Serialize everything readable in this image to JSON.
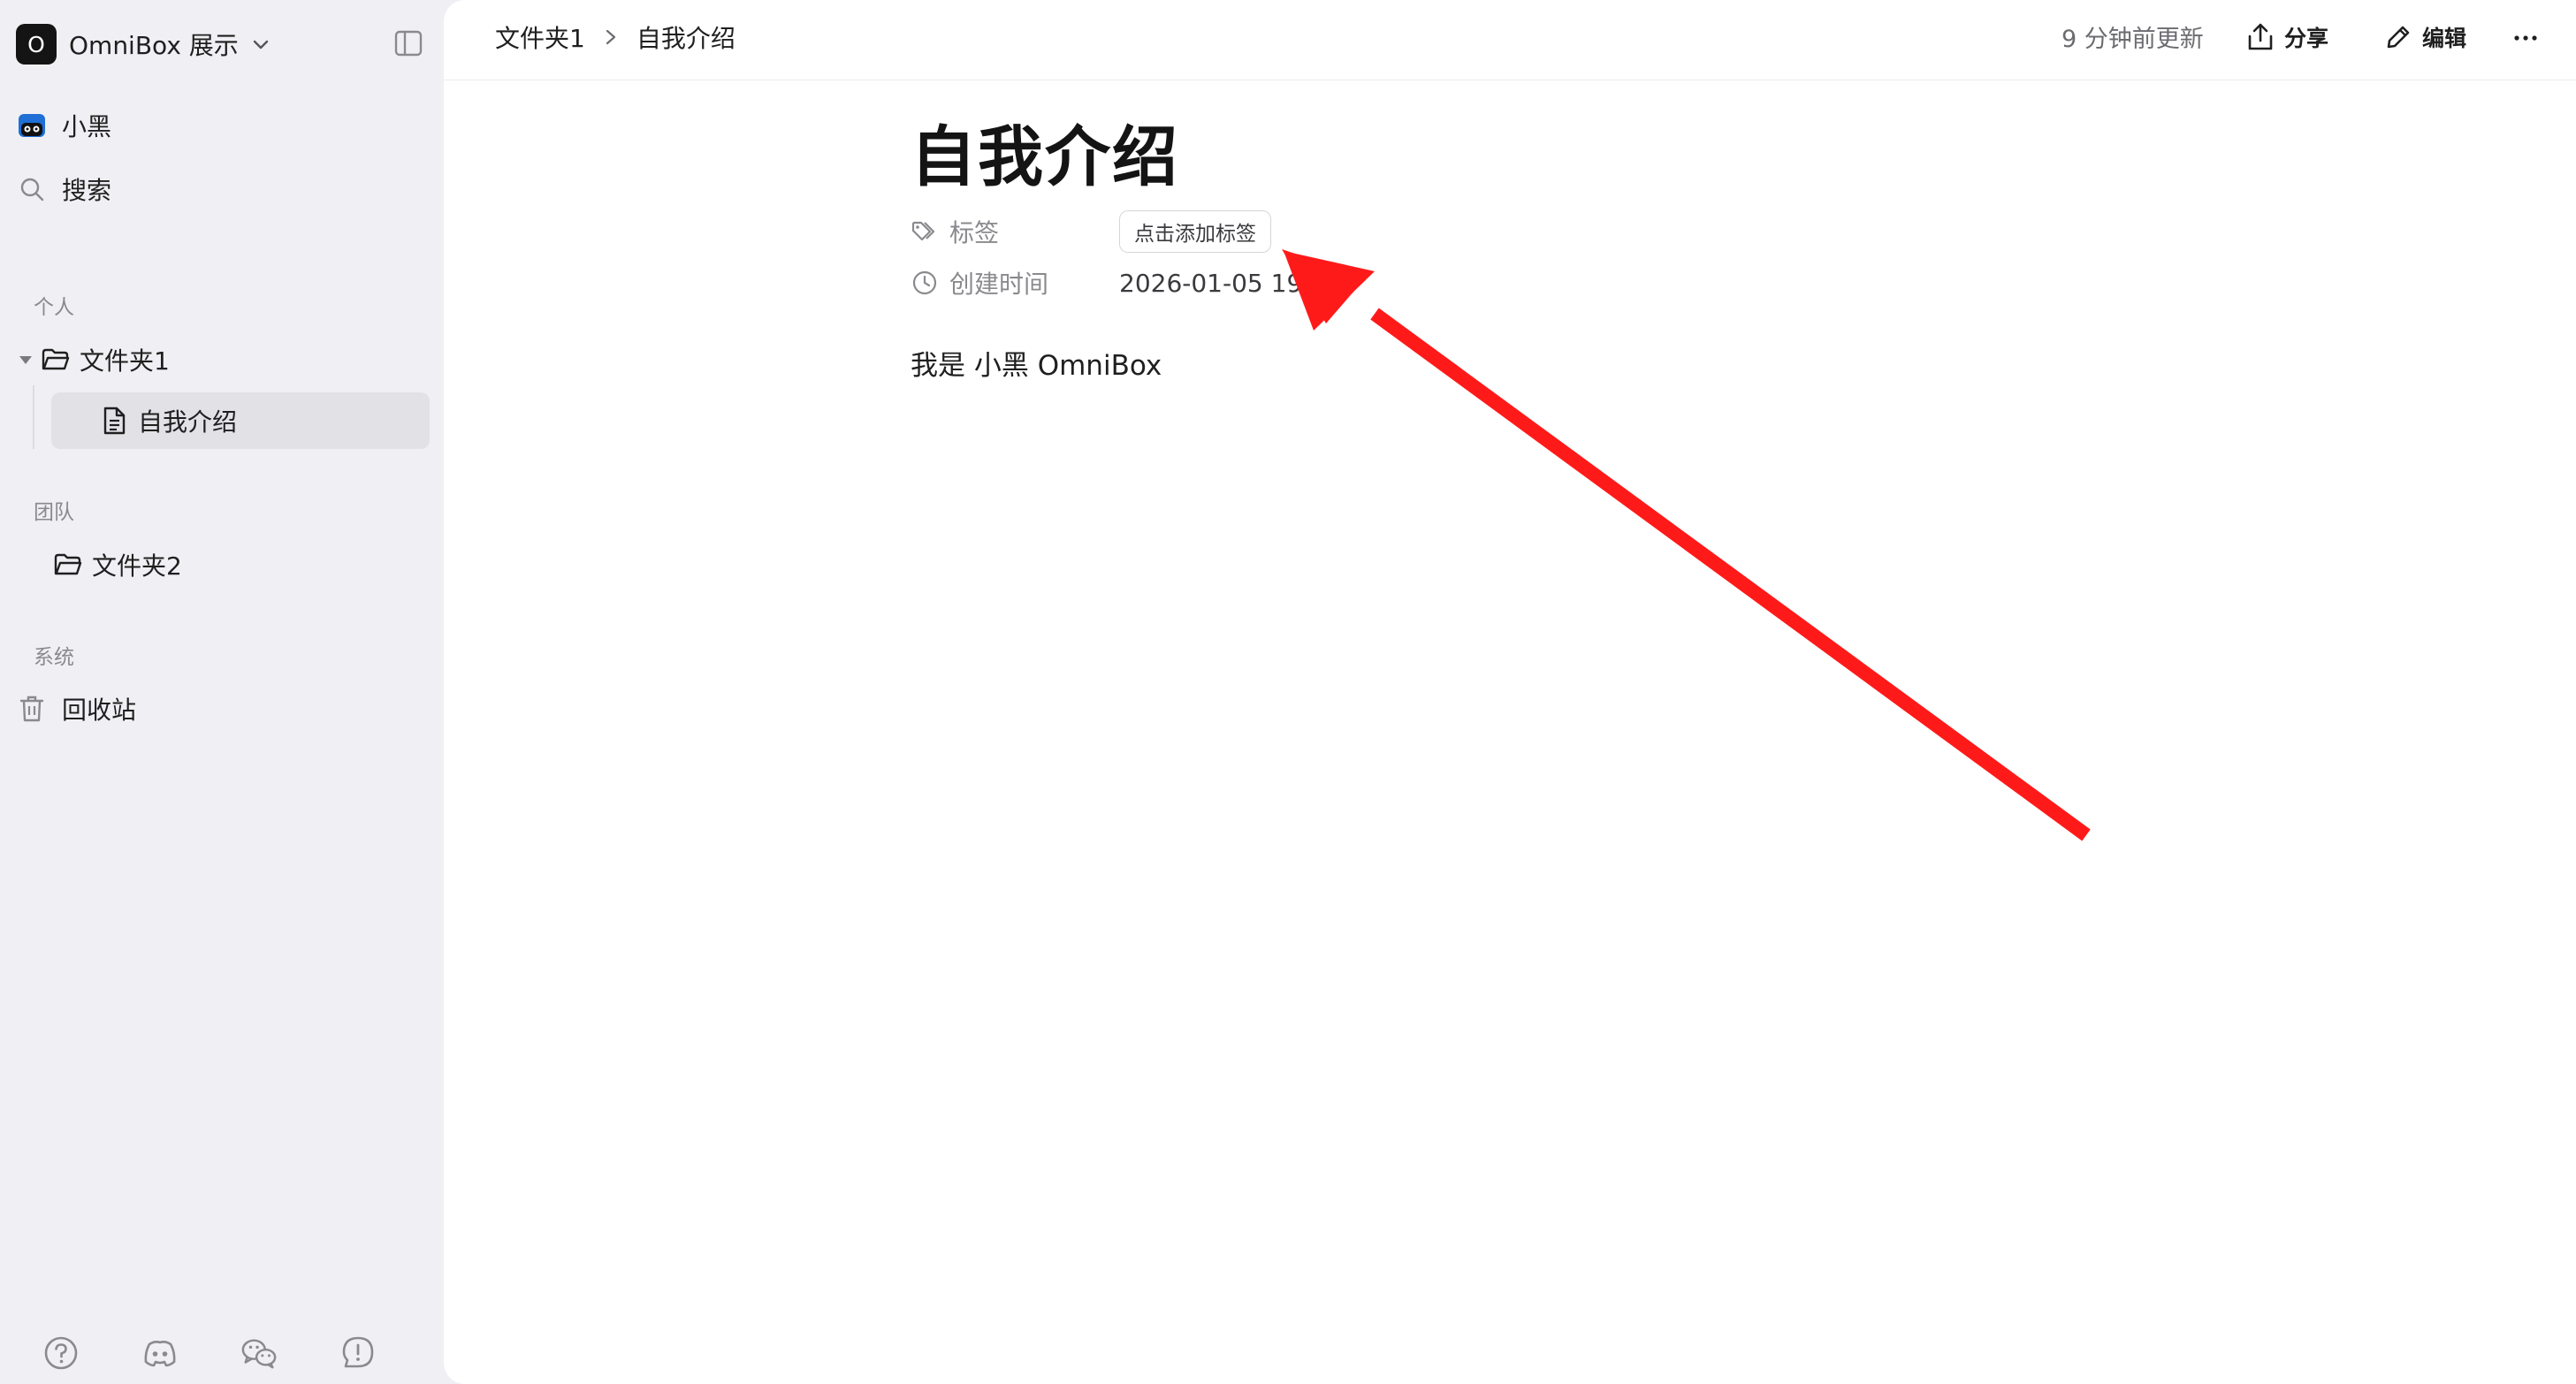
{
  "workspace": {
    "badge": "O",
    "name": "OmniBox 展示"
  },
  "sidebar": {
    "user": "小黑",
    "search": "搜索",
    "sections": {
      "personal": "个人",
      "team": "团队",
      "system": "系统"
    },
    "personal_items": {
      "folder": "文件夹1",
      "doc": "自我介绍"
    },
    "team_items": {
      "folder": "文件夹2"
    },
    "system_items": {
      "trash": "回收站"
    }
  },
  "topbar": {
    "breadcrumb": [
      "文件夹1",
      "自我介绍"
    ],
    "updated": "9 分钟前更新",
    "share_label": "分享",
    "edit_label": "编辑"
  },
  "document": {
    "title": "自我介绍",
    "props": {
      "tags_label": "标签",
      "tags_button": "点击添加标签",
      "created_label": "创建时间",
      "created_value": "2026-01-05 19:5"
    },
    "body": "我是 小黑 OmniBox"
  },
  "colors": {
    "annotation_arrow": "#ff1a1a",
    "sidebar_bg": "#f0f0f4",
    "selected_bg": "#e1e1e6"
  },
  "icons": {
    "sidebar_bottom": [
      "help-icon",
      "discord-icon",
      "wechat-icon",
      "feedback-icon"
    ]
  }
}
